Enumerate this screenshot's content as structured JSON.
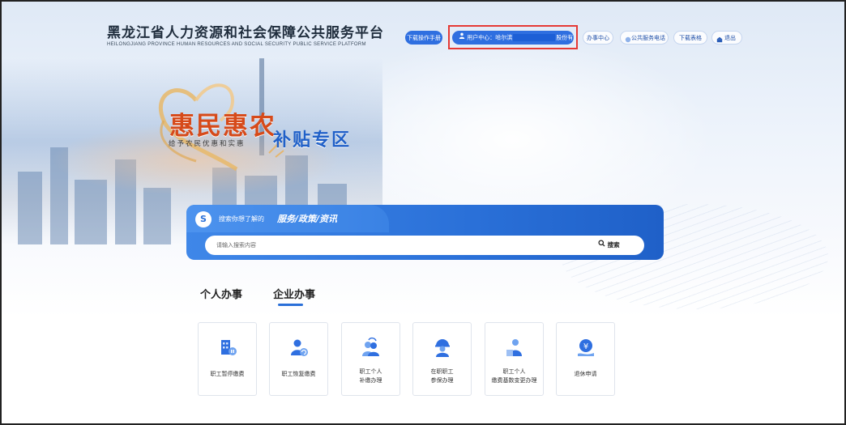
{
  "header": {
    "title": "黑龙江省人力资源和社会保障公共服务平台",
    "subtitle": "HEILONGJIANG PROVINCE HUMAN RESOURCES AND SOCIAL SECURITY PUBLIC SERVICE PLATFORM",
    "buttons": {
      "manual": "下载操作手册",
      "user_prefix": "用户中心：哈尔滨",
      "user_suffix": "股份有限公司",
      "office": "办事中心",
      "hotline": "公共服务电话",
      "forms": "下载表格",
      "logout": "退出"
    },
    "colors": {
      "primary": "#2f6fe0",
      "highlight_border": "#e53935"
    }
  },
  "banner": {
    "slogan_main": "惠民惠农",
    "slogan_sub": "给予农民优惠和实惠",
    "slogan_zone": "补贴专区"
  },
  "search": {
    "hint": "搜索你想了解的",
    "hint_strong": "服务/政策/资讯",
    "placeholder": "请输入搜索内容",
    "button": "搜索"
  },
  "tabs": [
    {
      "label": "个人办事",
      "active": false
    },
    {
      "label": "企业办事",
      "active": true
    }
  ],
  "services": [
    {
      "icon": "building-pause-icon",
      "label": "职工暂停缴费"
    },
    {
      "icon": "person-refresh-icon",
      "label": "职工恢复缴费"
    },
    {
      "icon": "people-replace-icon",
      "label": "职工个人\n补缴办理"
    },
    {
      "icon": "worker-helmet-icon",
      "label": "在职职工\n参保办理"
    },
    {
      "icon": "person-chart-icon",
      "label": "职工个人\n缴费基数变更办理"
    },
    {
      "icon": "yuan-hand-icon",
      "label": "退休申请"
    }
  ]
}
